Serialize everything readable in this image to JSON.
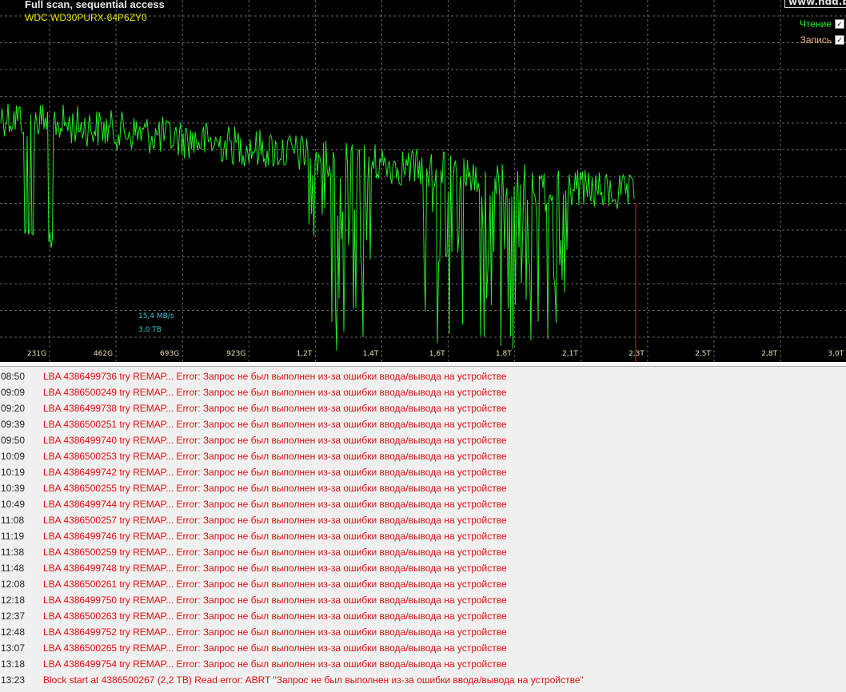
{
  "header": {
    "title": "Full scan, sequential access",
    "model": "WDC WD30PURX-64P6ZY0",
    "site": "www.hdd.b"
  },
  "legend": {
    "read_label": "Чтение",
    "read_checked": true,
    "write_label": "Запись",
    "write_checked": true,
    "check_glyph": "✓"
  },
  "info": {
    "speed": "15,4 MB/s",
    "capacity": "3,0 TB"
  },
  "x_labels": [
    "231G",
    "462G",
    "693G",
    "923G",
    "1,2T",
    "1,4T",
    "1,6T",
    "1,8T",
    "2,1T",
    "2,3T",
    "2,5T",
    "2,8T",
    "3,0T"
  ],
  "colors": {
    "read": "#22ee22",
    "write": "#f0b080",
    "cursor": "#d01010"
  },
  "log": [
    {
      "time": "08:50",
      "msg": "LBA 4386499736 try REMAP... Error: Запрос не был выполнен из-за ошибки ввода/вывода на устройстве"
    },
    {
      "time": "09:09",
      "msg": "LBA 4386500249 try REMAP... Error: Запрос не был выполнен из-за ошибки ввода/вывода на устройстве"
    },
    {
      "time": "09:20",
      "msg": "LBA 4386499738 try REMAP... Error: Запрос не был выполнен из-за ошибки ввода/вывода на устройстве"
    },
    {
      "time": "09:39",
      "msg": "LBA 4386500251 try REMAP... Error: Запрос не был выполнен из-за ошибки ввода/вывода на устройстве"
    },
    {
      "time": "09:50",
      "msg": "LBA 4386499740 try REMAP... Error: Запрос не был выполнен из-за ошибки ввода/вывода на устройстве"
    },
    {
      "time": "10:09",
      "msg": "LBA 4386500253 try REMAP... Error: Запрос не был выполнен из-за ошибки ввода/вывода на устройстве"
    },
    {
      "time": "10:19",
      "msg": "LBA 4386499742 try REMAP... Error: Запрос не был выполнен из-за ошибки ввода/вывода на устройстве"
    },
    {
      "time": "10:39",
      "msg": "LBA 4386500255 try REMAP... Error: Запрос не был выполнен из-за ошибки ввода/вывода на устройстве"
    },
    {
      "time": "10:49",
      "msg": "LBA 4386499744 try REMAP... Error: Запрос не был выполнен из-за ошибки ввода/вывода на устройстве"
    },
    {
      "time": "11:08",
      "msg": "LBA 4386500257 try REMAP... Error: Запрос не был выполнен из-за ошибки ввода/вывода на устройстве"
    },
    {
      "time": "11:19",
      "msg": "LBA 4386499746 try REMAP... Error: Запрос не был выполнен из-за ошибки ввода/вывода на устройстве"
    },
    {
      "time": "11:38",
      "msg": "LBA 4386500259 try REMAP... Error: Запрос не был выполнен из-за ошибки ввода/вывода на устройстве"
    },
    {
      "time": "11:48",
      "msg": "LBA 4386499748 try REMAP... Error: Запрос не был выполнен из-за ошибки ввода/вывода на устройстве"
    },
    {
      "time": "12:08",
      "msg": "LBA 4386500261 try REMAP... Error: Запрос не был выполнен из-за ошибки ввода/вывода на устройстве"
    },
    {
      "time": "12:18",
      "msg": "LBA 4386499750 try REMAP... Error: Запрос не был выполнен из-за ошибки ввода/вывода на устройстве"
    },
    {
      "time": "12:37",
      "msg": "LBA 4386500263 try REMAP... Error: Запрос не был выполнен из-за ошибки ввода/вывода на устройстве"
    },
    {
      "time": "12:48",
      "msg": "LBA 4386499752 try REMAP... Error: Запрос не был выполнен из-за ошибки ввода/вывода на устройстве"
    },
    {
      "time": "13:07",
      "msg": "LBA 4386500265 try REMAP... Error: Запрос не был выполнен из-за ошибки ввода/вывода на устройстве"
    },
    {
      "time": "13:18",
      "msg": "LBA 4386499754 try REMAP... Error: Запрос не был выполнен из-за ошибки ввода/вывода на устройстве"
    },
    {
      "time": "13:23",
      "msg": "Block start at 4386500267 (2,2 TB) Read error: ABRT \"Запрос не был выполнен из-за ошибки ввода/вывода на устройстве\""
    }
  ]
}
